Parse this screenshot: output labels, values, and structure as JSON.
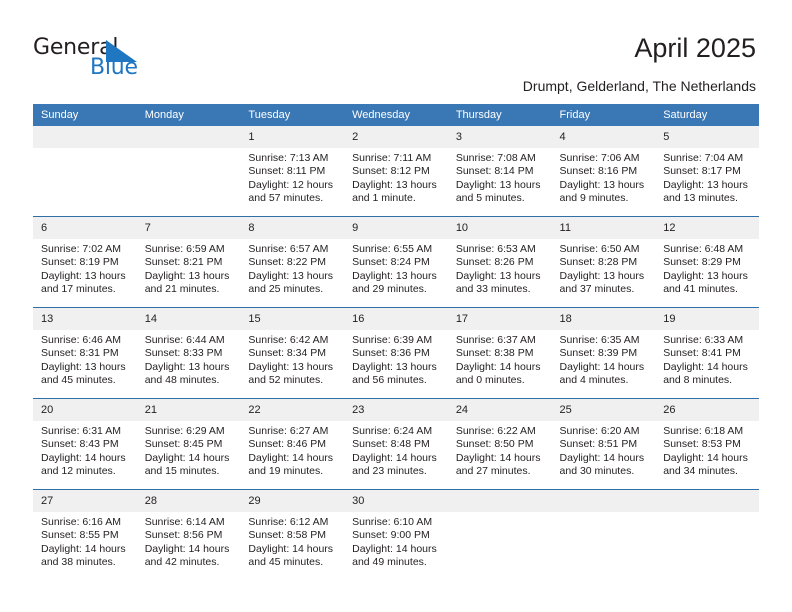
{
  "brand": {
    "name_part1": "General",
    "name_part2": "Blue",
    "accent_color": "#1f77c2",
    "triangle_icon": "triangle-icon"
  },
  "header": {
    "title": "April 2025",
    "subtitle": "Drumpt, Gelderland, The Netherlands"
  },
  "calendar": {
    "header_bg": "#3a77b5",
    "row_border_color": "#2f6fa8",
    "daynum_bg": "#f0f0f0",
    "weekday_headers": [
      "Sunday",
      "Monday",
      "Tuesday",
      "Wednesday",
      "Thursday",
      "Friday",
      "Saturday"
    ],
    "weeks": [
      [
        {
          "day": "",
          "info": ""
        },
        {
          "day": "",
          "info": ""
        },
        {
          "day": "1",
          "info": "Sunrise: 7:13 AM\nSunset: 8:11 PM\nDaylight: 12 hours and 57 minutes."
        },
        {
          "day": "2",
          "info": "Sunrise: 7:11 AM\nSunset: 8:12 PM\nDaylight: 13 hours and 1 minute."
        },
        {
          "day": "3",
          "info": "Sunrise: 7:08 AM\nSunset: 8:14 PM\nDaylight: 13 hours and 5 minutes."
        },
        {
          "day": "4",
          "info": "Sunrise: 7:06 AM\nSunset: 8:16 PM\nDaylight: 13 hours and 9 minutes."
        },
        {
          "day": "5",
          "info": "Sunrise: 7:04 AM\nSunset: 8:17 PM\nDaylight: 13 hours and 13 minutes."
        }
      ],
      [
        {
          "day": "6",
          "info": "Sunrise: 7:02 AM\nSunset: 8:19 PM\nDaylight: 13 hours and 17 minutes."
        },
        {
          "day": "7",
          "info": "Sunrise: 6:59 AM\nSunset: 8:21 PM\nDaylight: 13 hours and 21 minutes."
        },
        {
          "day": "8",
          "info": "Sunrise: 6:57 AM\nSunset: 8:22 PM\nDaylight: 13 hours and 25 minutes."
        },
        {
          "day": "9",
          "info": "Sunrise: 6:55 AM\nSunset: 8:24 PM\nDaylight: 13 hours and 29 minutes."
        },
        {
          "day": "10",
          "info": "Sunrise: 6:53 AM\nSunset: 8:26 PM\nDaylight: 13 hours and 33 minutes."
        },
        {
          "day": "11",
          "info": "Sunrise: 6:50 AM\nSunset: 8:28 PM\nDaylight: 13 hours and 37 minutes."
        },
        {
          "day": "12",
          "info": "Sunrise: 6:48 AM\nSunset: 8:29 PM\nDaylight: 13 hours and 41 minutes."
        }
      ],
      [
        {
          "day": "13",
          "info": "Sunrise: 6:46 AM\nSunset: 8:31 PM\nDaylight: 13 hours and 45 minutes."
        },
        {
          "day": "14",
          "info": "Sunrise: 6:44 AM\nSunset: 8:33 PM\nDaylight: 13 hours and 48 minutes."
        },
        {
          "day": "15",
          "info": "Sunrise: 6:42 AM\nSunset: 8:34 PM\nDaylight: 13 hours and 52 minutes."
        },
        {
          "day": "16",
          "info": "Sunrise: 6:39 AM\nSunset: 8:36 PM\nDaylight: 13 hours and 56 minutes."
        },
        {
          "day": "17",
          "info": "Sunrise: 6:37 AM\nSunset: 8:38 PM\nDaylight: 14 hours and 0 minutes."
        },
        {
          "day": "18",
          "info": "Sunrise: 6:35 AM\nSunset: 8:39 PM\nDaylight: 14 hours and 4 minutes."
        },
        {
          "day": "19",
          "info": "Sunrise: 6:33 AM\nSunset: 8:41 PM\nDaylight: 14 hours and 8 minutes."
        }
      ],
      [
        {
          "day": "20",
          "info": "Sunrise: 6:31 AM\nSunset: 8:43 PM\nDaylight: 14 hours and 12 minutes."
        },
        {
          "day": "21",
          "info": "Sunrise: 6:29 AM\nSunset: 8:45 PM\nDaylight: 14 hours and 15 minutes."
        },
        {
          "day": "22",
          "info": "Sunrise: 6:27 AM\nSunset: 8:46 PM\nDaylight: 14 hours and 19 minutes."
        },
        {
          "day": "23",
          "info": "Sunrise: 6:24 AM\nSunset: 8:48 PM\nDaylight: 14 hours and 23 minutes."
        },
        {
          "day": "24",
          "info": "Sunrise: 6:22 AM\nSunset: 8:50 PM\nDaylight: 14 hours and 27 minutes."
        },
        {
          "day": "25",
          "info": "Sunrise: 6:20 AM\nSunset: 8:51 PM\nDaylight: 14 hours and 30 minutes."
        },
        {
          "day": "26",
          "info": "Sunrise: 6:18 AM\nSunset: 8:53 PM\nDaylight: 14 hours and 34 minutes."
        }
      ],
      [
        {
          "day": "27",
          "info": "Sunrise: 6:16 AM\nSunset: 8:55 PM\nDaylight: 14 hours and 38 minutes."
        },
        {
          "day": "28",
          "info": "Sunrise: 6:14 AM\nSunset: 8:56 PM\nDaylight: 14 hours and 42 minutes."
        },
        {
          "day": "29",
          "info": "Sunrise: 6:12 AM\nSunset: 8:58 PM\nDaylight: 14 hours and 45 minutes."
        },
        {
          "day": "30",
          "info": "Sunrise: 6:10 AM\nSunset: 9:00 PM\nDaylight: 14 hours and 49 minutes."
        },
        {
          "day": "",
          "info": ""
        },
        {
          "day": "",
          "info": ""
        },
        {
          "day": "",
          "info": ""
        }
      ]
    ]
  }
}
